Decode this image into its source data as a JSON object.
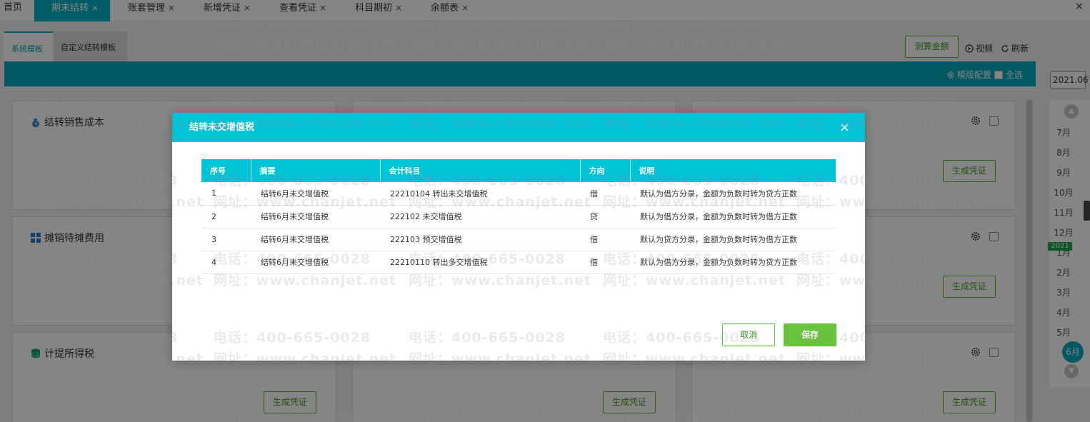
{
  "tabs": [
    {
      "label": "首页",
      "closable": false
    },
    {
      "label": "期末结转",
      "closable": true,
      "active": true
    },
    {
      "label": "账套管理",
      "closable": true
    },
    {
      "label": "新增凭证",
      "closable": true
    },
    {
      "label": "查看凭证",
      "closable": true
    },
    {
      "label": "科目期初",
      "closable": true
    },
    {
      "label": "余额表",
      "closable": true
    }
  ],
  "tab_close_glyph": "×",
  "subtabs": {
    "system": "系统模板",
    "custom": "自定义结转模板"
  },
  "actions": {
    "calc_amount": "测算金额",
    "video": "视频",
    "refresh": "刷新"
  },
  "toolbar": {
    "template_config": "模版配置",
    "select_all": "全选"
  },
  "period": {
    "value": "2021.06",
    "year_badge": "2021",
    "current_month": "6月"
  },
  "months": [
    "7月",
    "8月",
    "9月",
    "10月",
    "11月",
    "12月",
    "1月",
    "2月",
    "3月",
    "4月",
    "5月"
  ],
  "cards": {
    "c1": {
      "title": "结转销售成本",
      "icon": "coin-bag-icon"
    },
    "c2": {
      "title": "摊销待摊费用",
      "icon": "grid-icon"
    },
    "c3": {
      "title": "计提所得税",
      "icon": "coin-stack-icon"
    },
    "generate_label": "生成凭证"
  },
  "watermark": {
    "phone": "电话：400-665-0028",
    "site": "网址：www.chanjet.net"
  },
  "modal": {
    "title": "结转未交增值税",
    "close_glyph": "×",
    "columns": [
      "序号",
      "摘要",
      "会计科目",
      "方向",
      "说明"
    ],
    "rows": [
      {
        "no": "1",
        "summary": "结转6月未交增值税",
        "account": "22210104 转出未交增值税",
        "direction": "借",
        "note": "默认为借方分录，金额为负数时转为贷方正数"
      },
      {
        "no": "2",
        "summary": "结转6月未交增值税",
        "account": "222102 未交增值税",
        "direction": "贷",
        "note": "默认为借方分录，金额为负数时转为借方正数"
      },
      {
        "no": "3",
        "summary": "结转6月未交增值税",
        "account": "222103 预交增值税",
        "direction": "借",
        "note": "默认为贷方分录，金额为负数时转为借方正数"
      },
      {
        "no": "4",
        "summary": "结转6月未交增值税",
        "account": "22210110 转出多交增值税",
        "direction": "借",
        "note": "默认为借方分录，金额为负数时转为贷方正数"
      }
    ],
    "cancel": "取消",
    "save": "保存"
  },
  "colors": {
    "teal": "#00a9bd",
    "modal_teal": "#00c3d8",
    "green": "#68c43a",
    "badge_green": "#16a34a"
  }
}
